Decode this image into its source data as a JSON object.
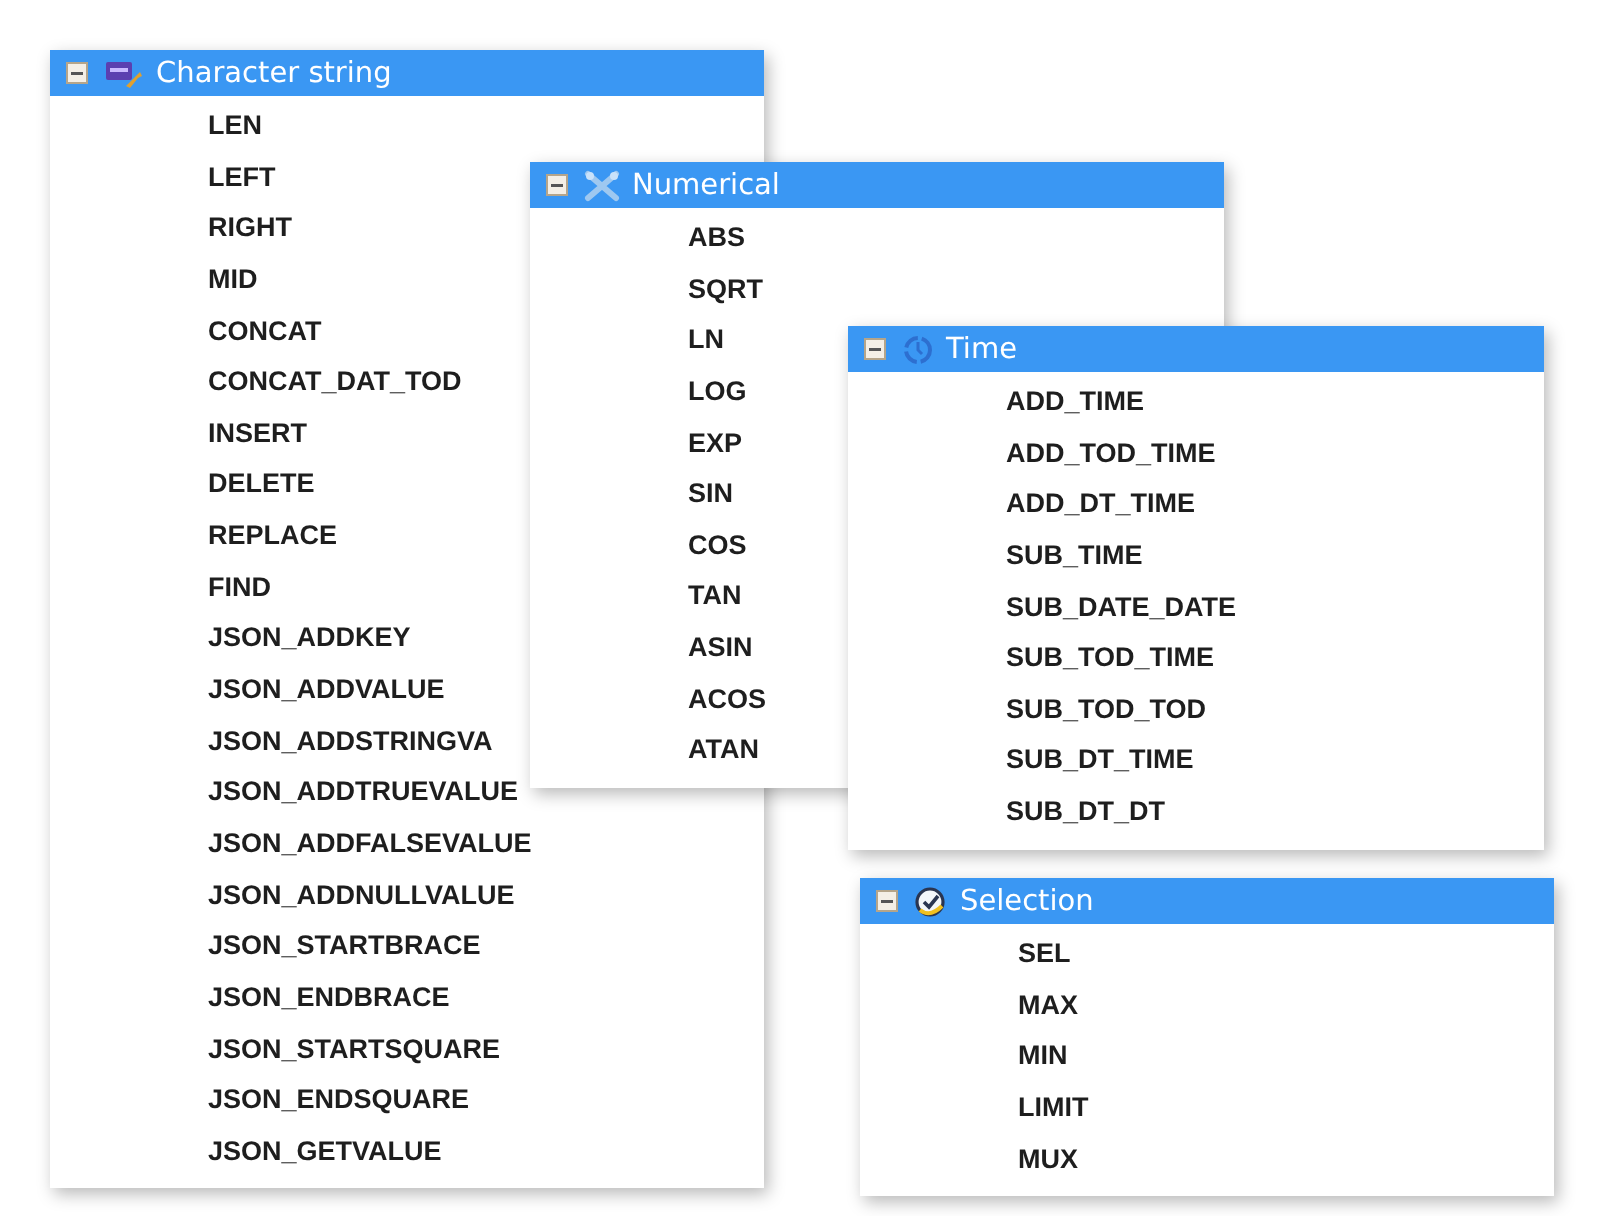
{
  "groups": [
    {
      "title": "Character string",
      "kind": "string",
      "expanded": true,
      "items": [
        "LEN",
        "LEFT",
        "RIGHT",
        "MID",
        "CONCAT",
        "CONCAT_DAT_TOD",
        "INSERT",
        "DELETE",
        "REPLACE",
        "FIND",
        "JSON_ADDKEY",
        "JSON_ADDVALUE",
        "JSON_ADDSTRINGVA",
        "JSON_ADDTRUEVALUE",
        "JSON_ADDFALSEVALUE",
        "JSON_ADDNULLVALUE",
        "JSON_STARTBRACE",
        "JSON_ENDBRACE",
        "JSON_STARTSQUARE",
        "JSON_ENDSQUARE",
        "JSON_GETVALUE"
      ]
    },
    {
      "title": "Numerical",
      "kind": "numerical",
      "expanded": true,
      "items": [
        "ABS",
        "SQRT",
        "LN",
        "LOG",
        "EXP",
        "SIN",
        "COS",
        "TAN",
        "ASIN",
        "ACOS",
        "ATAN"
      ]
    },
    {
      "title": "Time",
      "kind": "time",
      "expanded": true,
      "items": [
        "ADD_TIME",
        "ADD_TOD_TIME",
        "ADD_DT_TIME",
        "SUB_TIME",
        "SUB_DATE_DATE",
        "SUB_TOD_TIME",
        "SUB_TOD_TOD",
        "SUB_DT_TIME",
        "SUB_DT_DT"
      ]
    },
    {
      "title": "Selection",
      "kind": "selection",
      "expanded": true,
      "items": [
        "SEL",
        "MAX",
        "MIN",
        "LIMIT",
        "MUX"
      ]
    }
  ]
}
